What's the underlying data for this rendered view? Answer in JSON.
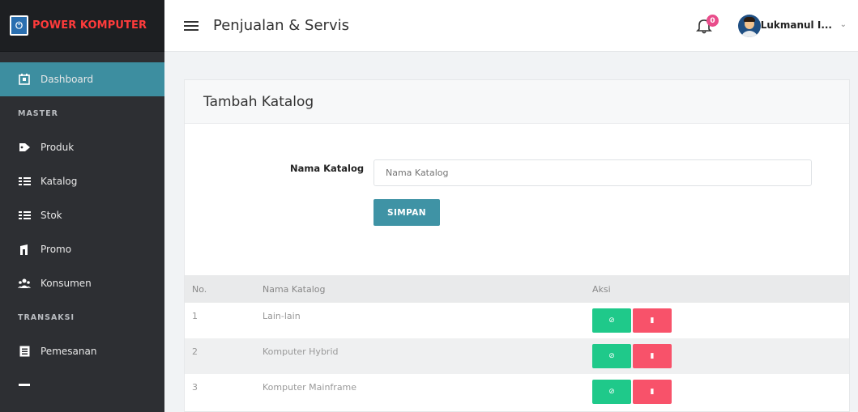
{
  "brand": {
    "name": "POWER KOMPUTER",
    "logo_icon": "power"
  },
  "topbar": {
    "title": "Penjualan & Servis",
    "notifications": "0",
    "user": "Lukmanul I..."
  },
  "sidebar": {
    "items": [
      {
        "label": "Dashboard",
        "icon": "building-icon",
        "active": true
      },
      {
        "section": "MASTER"
      },
      {
        "label": "Produk",
        "icon": "tag-icon"
      },
      {
        "label": "Katalog",
        "icon": "list-icon"
      },
      {
        "label": "Stok",
        "icon": "list-icon"
      },
      {
        "label": "Promo",
        "icon": "shop-icon"
      },
      {
        "label": "Konsumen",
        "icon": "users-icon"
      },
      {
        "section": "TRANSAKSI"
      },
      {
        "label": "Pemesanan",
        "icon": "document-icon"
      }
    ]
  },
  "card": {
    "title": "Tambah Katalog",
    "form": {
      "label": "Nama Katalog",
      "input_value": "",
      "placeholder": "Nama Katalog",
      "submit": "SIMPAN"
    },
    "table": {
      "headers": [
        "No.",
        "Nama Katalog",
        "Aksi"
      ],
      "rows": [
        {
          "no": "1",
          "name": "Lain-lain"
        },
        {
          "no": "2",
          "name": "Komputer Hybrid"
        },
        {
          "no": "3",
          "name": "Komputer Mainframe"
        }
      ]
    }
  },
  "colors": {
    "sidebar_bg": "#2d2f33",
    "active": "#3d8ea0",
    "brand": "#ff3b3b",
    "edit": "#1fc98a",
    "delete": "#f8526a"
  }
}
